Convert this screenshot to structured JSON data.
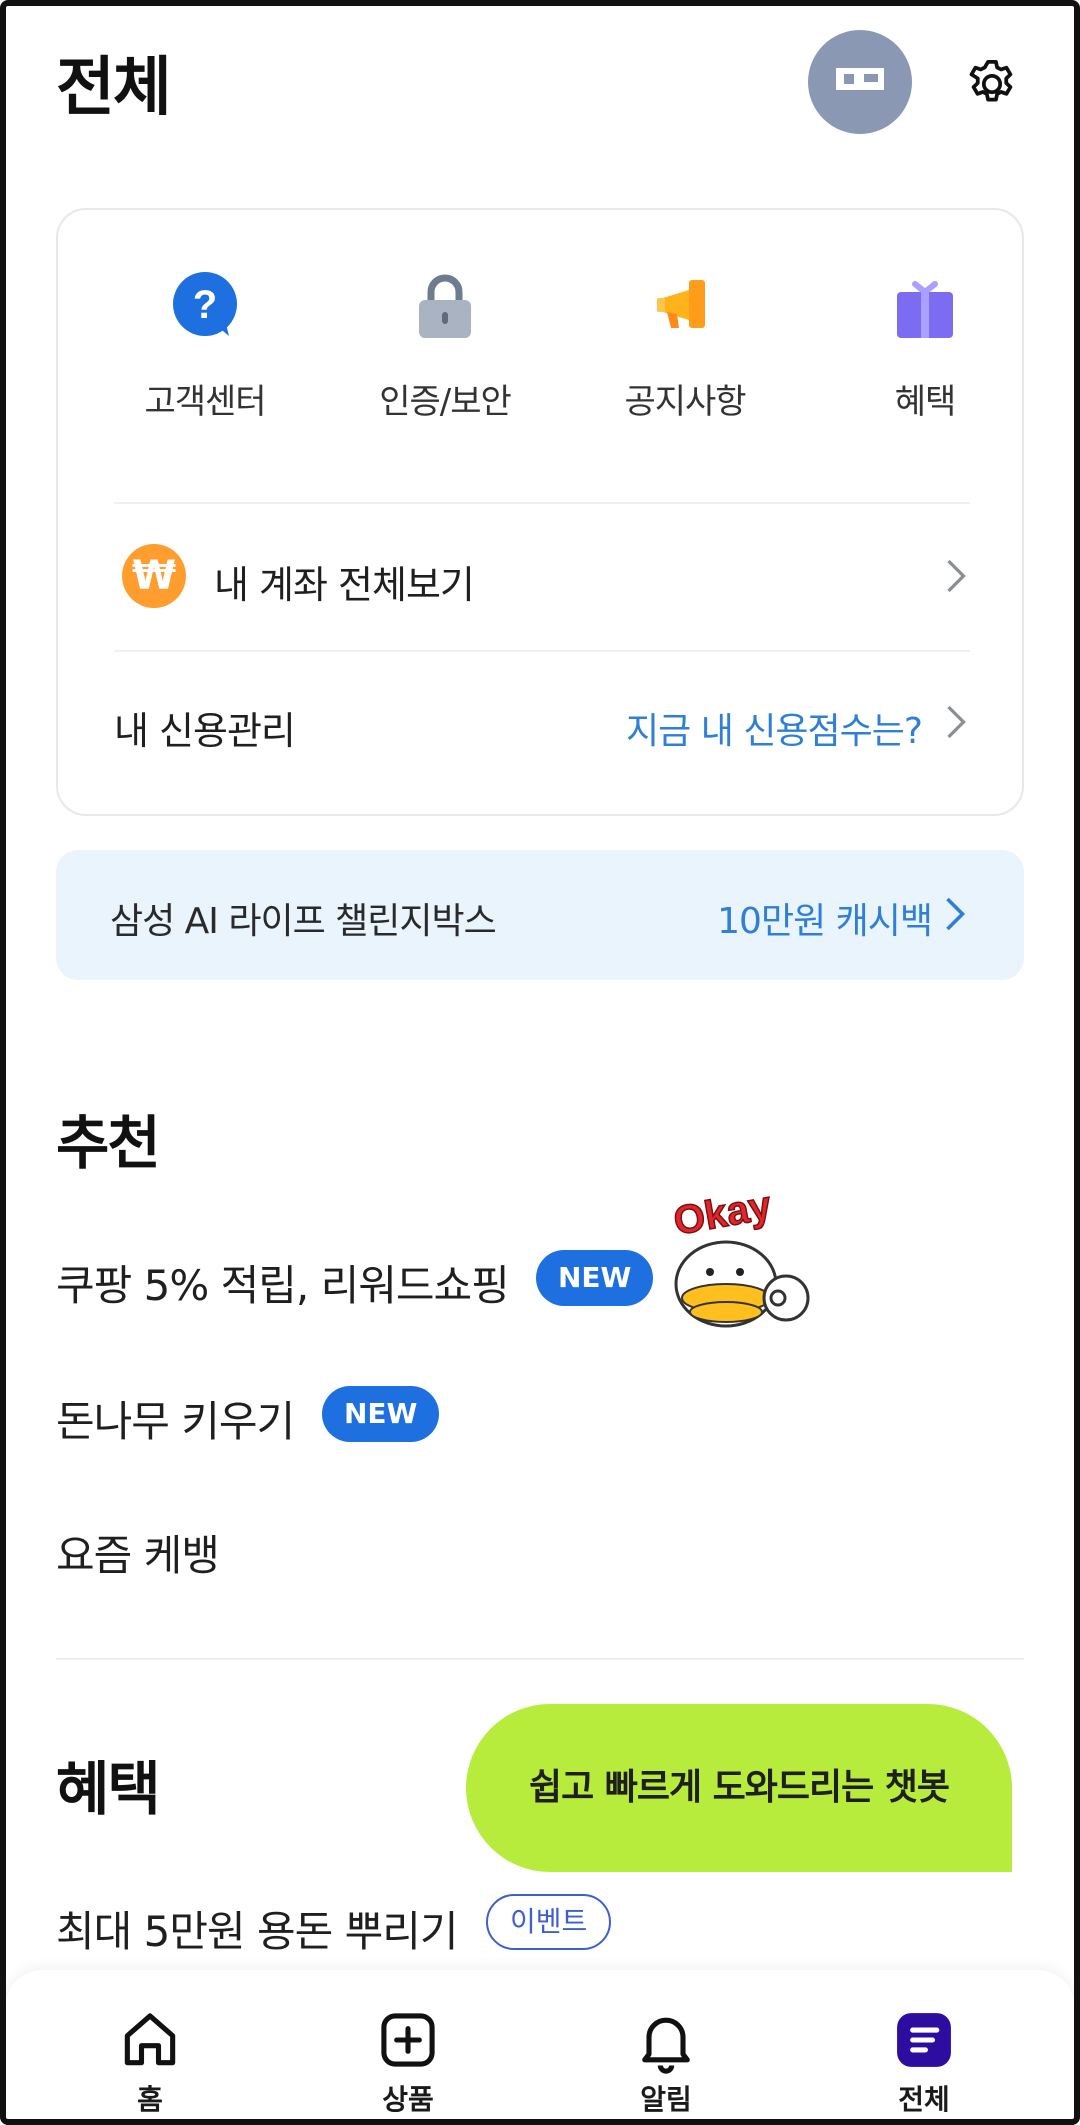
{
  "header": {
    "title": "전체",
    "avatar_icon": "avatar-icon",
    "settings_icon": "gear-icon"
  },
  "quick_menu": [
    {
      "label": "고객센터",
      "icon": "question-bubble-icon",
      "color": "#1e6fe0"
    },
    {
      "label": "인증/보안",
      "icon": "lock-icon",
      "color": "#a9b3c1"
    },
    {
      "label": "공지사항",
      "icon": "megaphone-icon",
      "color": "#ffb31a"
    },
    {
      "label": "혜택",
      "icon": "gift-icon",
      "color": "#7b6cf2"
    }
  ],
  "accounts_row": {
    "label": "내 계좌 전체보기",
    "badge": "₩",
    "badge_color": "#ff9d2e"
  },
  "credit_row": {
    "label": "내 신용관리",
    "link": "지금 내 신용점수는?"
  },
  "banner": {
    "label": "삼성 AI 라이프 챌린지박스",
    "link": "10만원 캐시백"
  },
  "recommend": {
    "title": "추천",
    "items": [
      {
        "label": "쿠팡 5% 적립, 리워드쇼핑",
        "badge": "NEW"
      },
      {
        "label": "돈나무 키우기",
        "badge": "NEW"
      },
      {
        "label": "요즘 케뱅"
      }
    ]
  },
  "benefits": {
    "title": "혜택",
    "items": [
      {
        "label": "최대 5만원 용돈 뿌리기",
        "badge": "이벤트"
      }
    ]
  },
  "chatbot": {
    "label": "쉽고 빠르게 도와드리는 챗봇",
    "color": "#b7ec3d"
  },
  "bottom_nav": [
    {
      "label": "홈",
      "icon": "home-icon"
    },
    {
      "label": "상품",
      "icon": "plus-square-icon"
    },
    {
      "label": "알림",
      "icon": "bell-icon"
    },
    {
      "label": "전체",
      "icon": "menu-icon",
      "active": true,
      "color": "#2d0ca0"
    }
  ],
  "colors": {
    "accent_blue": "#1e6fe0",
    "link_blue": "#2f7fd6",
    "banner_bg": "#e9f4fd"
  }
}
